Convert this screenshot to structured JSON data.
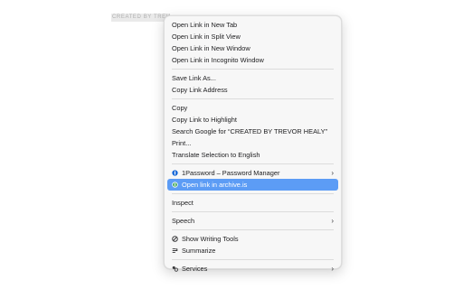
{
  "selection": {
    "text": "CREATED BY TREVOR HEALY"
  },
  "menu": {
    "group1": [
      {
        "label": "Open Link in New Tab"
      },
      {
        "label": "Open Link in Split View"
      },
      {
        "label": "Open Link in New Window"
      },
      {
        "label": "Open Link in Incognito Window"
      }
    ],
    "group2": [
      {
        "label": "Save Link As..."
      },
      {
        "label": "Copy Link Address"
      }
    ],
    "group3": [
      {
        "label": "Copy"
      },
      {
        "label": "Copy Link to Highlight"
      },
      {
        "label": "Search Google for “CREATED BY TREVOR HEALY”"
      },
      {
        "label": "Print..."
      },
      {
        "label": "Translate Selection to English"
      }
    ],
    "extensions": [
      {
        "label": "1Password – Password Manager",
        "icon": "1password-icon",
        "submenu": true
      },
      {
        "label": "Open link in archive.is",
        "icon": "archive-icon",
        "highlighted": true
      }
    ],
    "inspect": {
      "label": "Inspect"
    },
    "speech": {
      "label": "Speech",
      "submenu": true
    },
    "writing": [
      {
        "label": "Show Writing Tools",
        "icon": "writing-tools-icon"
      },
      {
        "label": "Summarize",
        "icon": "summarize-icon"
      }
    ],
    "services": {
      "label": "Services",
      "icon": "services-icon",
      "submenu": true
    }
  },
  "colors": {
    "highlight": "#5c9cf5",
    "menu_background": "#f7f7f7",
    "text": "#1d1d1f"
  }
}
